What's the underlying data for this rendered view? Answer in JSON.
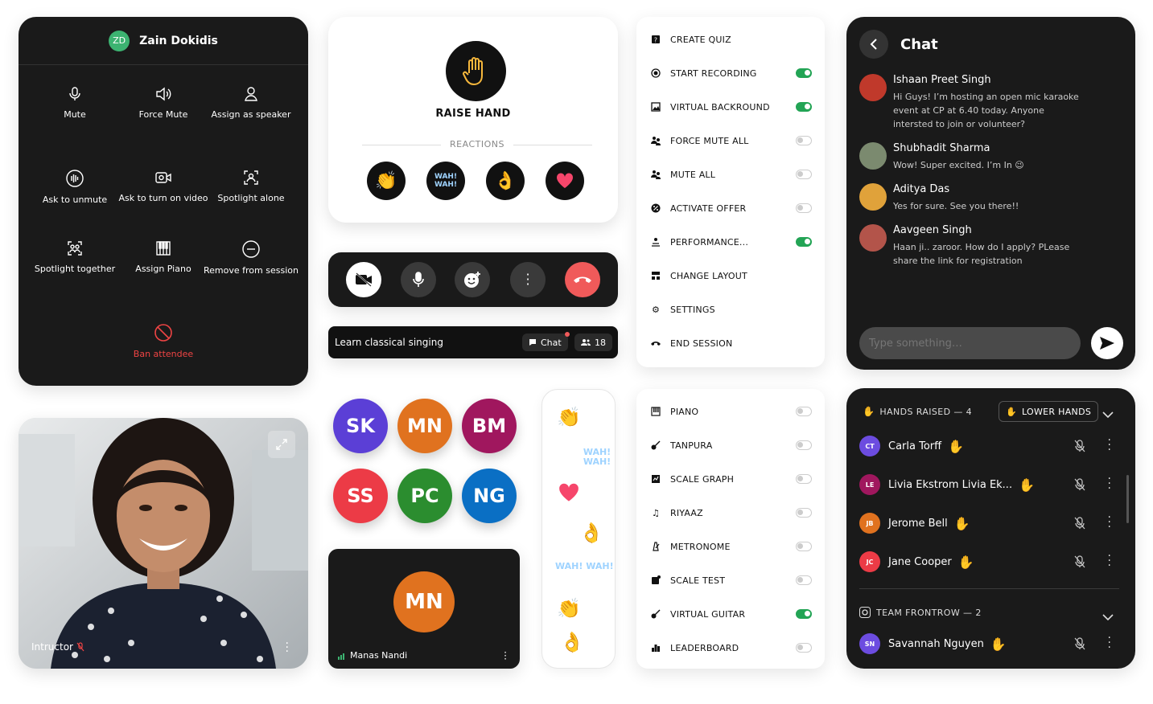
{
  "panel": {
    "initials": "ZD",
    "name": "Zain Dokidis",
    "actions": [
      {
        "label": "Mute",
        "icon": "microphone-icon"
      },
      {
        "label": "Force Mute",
        "icon": "speaker-icon"
      },
      {
        "label": "Assign as speaker",
        "icon": "user-icon"
      },
      {
        "label": "Ask to unmute",
        "icon": "sound-wave-icon"
      },
      {
        "label": "Ask to turn on video",
        "icon": "video-camera-icon"
      },
      {
        "label": "Spotlight alone",
        "icon": "spotlight-icon"
      },
      {
        "label": "Spotlight together",
        "icon": "group-spotlight-icon"
      },
      {
        "label": "Assign Piano",
        "icon": "piano-icon"
      },
      {
        "label": "Remove from session",
        "icon": "remove-icon"
      },
      {
        "label": "Ban attendee",
        "icon": "ban-icon"
      }
    ]
  },
  "video": {
    "label": "Intructor"
  },
  "raise_hand": {
    "title": "RAISE HAND",
    "reactions_label": "REACTIONS",
    "reactions": [
      "clap",
      "wah-wah",
      "ok",
      "heart"
    ],
    "sticker_text": "WAH! WAH!"
  },
  "controls": [
    "camera-off",
    "microphone",
    "emoji",
    "more",
    "end-call"
  ],
  "session_bar": {
    "title": "Learn classical singing",
    "chat_label": "Chat",
    "participants": "18"
  },
  "avatars": [
    {
      "initials": "SK",
      "color": "#5b3fd6"
    },
    {
      "initials": "MN",
      "color": "#e0721f"
    },
    {
      "initials": "BM",
      "color": "#a0175e"
    },
    {
      "initials": "SS",
      "color": "#ec3b46"
    },
    {
      "initials": "PC",
      "color": "#2b8d2f"
    },
    {
      "initials": "NG",
      "color": "#0a6fc4"
    }
  ],
  "tile": {
    "initials": "MN",
    "name": "Manas Nandi"
  },
  "menu1": [
    {
      "label": "CREATE QUIZ",
      "icon": "quiz-icon",
      "toggle": null
    },
    {
      "label": "START RECORDING",
      "icon": "record-icon",
      "toggle": true
    },
    {
      "label": "VIRTUAL BACKROUND",
      "icon": "background-icon",
      "toggle": true
    },
    {
      "label": "FORCE MUTE ALL",
      "icon": "group-mute-icon",
      "toggle": false
    },
    {
      "label": "MUTE ALL",
      "icon": "group-icon",
      "toggle": false
    },
    {
      "label": "ACTIVATE OFFER",
      "icon": "offer-icon",
      "toggle": false
    },
    {
      "label": "PERFORMANCE...",
      "icon": "performance-icon",
      "toggle": true
    },
    {
      "label": "CHANGE LAYOUT",
      "icon": "layout-icon",
      "toggle": null
    },
    {
      "label": "SETTINGS",
      "icon": "gear-icon",
      "toggle": null
    },
    {
      "label": "END SESSION",
      "icon": "end-call-icon",
      "toggle": null
    }
  ],
  "menu2": [
    {
      "label": "PIANO",
      "icon": "piano-icon",
      "toggle": false
    },
    {
      "label": "TANPURA",
      "icon": "tanpura-icon",
      "toggle": false
    },
    {
      "label": "SCALE GRAPH",
      "icon": "graph-icon",
      "toggle": false
    },
    {
      "label": "RIYAAZ",
      "icon": "music-note-icon",
      "toggle": false
    },
    {
      "label": "METRONOME",
      "icon": "metronome-icon",
      "toggle": false
    },
    {
      "label": "SCALE TEST",
      "icon": "test-icon",
      "toggle": false
    },
    {
      "label": "VIRTUAL GUITAR",
      "icon": "guitar-icon",
      "toggle": true
    },
    {
      "label": "LEADERBOARD",
      "icon": "leaderboard-icon",
      "toggle": false
    }
  ],
  "chat": {
    "title": "Chat",
    "messages": [
      {
        "name": "Ishaan Preet Singh",
        "text": "Hi Guys! I’m hosting an open mic karaoke event at CP at 6.40 today. Anyone intersted to join or volunteer?",
        "color": "#c0392b"
      },
      {
        "name": "Shubhadit Sharma",
        "text": "Wow! Super excited. I’m In 😉",
        "color": "#7b8a6f"
      },
      {
        "name": "Aditya Das",
        "text": "Yes for sure. See you there!!",
        "color": "#e0a23a"
      },
      {
        "name": "Aavgeen Singh",
        "text": "Haan ji.. zaroor. How do I apply? PLease share the link for registration",
        "color": "#b3544a"
      }
    ],
    "placeholder": "Type something…"
  },
  "hands": {
    "header": "HANDS RAISED — 4",
    "lower_label": "LOWER HANDS",
    "people": [
      {
        "initials": "CT",
        "name": "Carla Torff",
        "color": "#6c4ce0"
      },
      {
        "initials": "LE",
        "name": "Livia Ekstrom Livia Ek...",
        "color": "#a0175e"
      },
      {
        "initials": "JB",
        "name": "Jerome Bell",
        "color": "#e0721f"
      },
      {
        "initials": "JC",
        "name": "Jane Cooper",
        "color": "#ec3b46"
      }
    ],
    "team_header": "TEAM FRONTROW — 2",
    "team": [
      {
        "initials": "SN",
        "name": "Savannah Nguyen",
        "color": "#6c4ce0"
      }
    ]
  }
}
